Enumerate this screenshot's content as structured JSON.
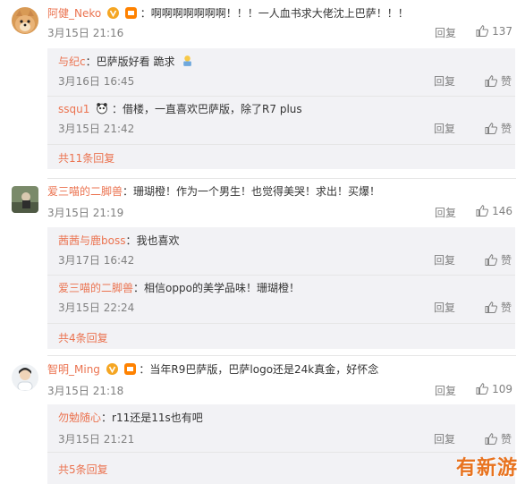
{
  "comments": [
    {
      "user": "阿健_Neko",
      "text": "啊啊啊啊啊啊啊！！！一人血书求大佬沈上巴萨！！！",
      "time": "3月15日 21:16",
      "reply": "回复",
      "likes": "137",
      "replies": [
        {
          "user": "与纪c",
          "text": "巴萨版好看 跪求",
          "time": "3月16日 16:45",
          "reply": "回复",
          "like": "赞"
        },
        {
          "user": "ssqu1",
          "text": "借楼，一直喜欢巴萨版，除了R7 plus",
          "time": "3月15日 21:42",
          "reply": "回复",
          "like": "赞"
        }
      ],
      "more": "共11条回复"
    },
    {
      "user": "爱三喵的二脚兽",
      "text": "珊瑚橙！作为一个男生！也觉得美哭！求出！买爆！",
      "time": "3月15日 21:19",
      "reply": "回复",
      "likes": "146",
      "replies": [
        {
          "user": "茜茜与鹿boss",
          "text": "我也喜欢",
          "time": "3月17日 16:42",
          "reply": "回复",
          "like": "赞"
        },
        {
          "user": "爱三喵的二脚兽",
          "text": "相信oppo的美学品味！珊瑚橙！",
          "time": "3月15日 22:24",
          "reply": "回复",
          "like": "赞"
        }
      ],
      "more": "共4条回复"
    },
    {
      "user": "智明_Ming",
      "text": "当年R9巴萨版，巴萨logo还是24k真金，好怀念",
      "time": "3月15日 21:18",
      "reply": "回复",
      "likes": "109",
      "replies": [
        {
          "user": "勿勉随心",
          "text": "r11还是11s也有吧",
          "time": "3月15日 21:21",
          "reply": "回复",
          "like": "赞"
        }
      ],
      "more": "共5条回复"
    }
  ],
  "watermark": "有新游",
  "colors": {
    "username": "#eb7350",
    "meta": "#808080",
    "subBg": "#f2f2f5"
  }
}
